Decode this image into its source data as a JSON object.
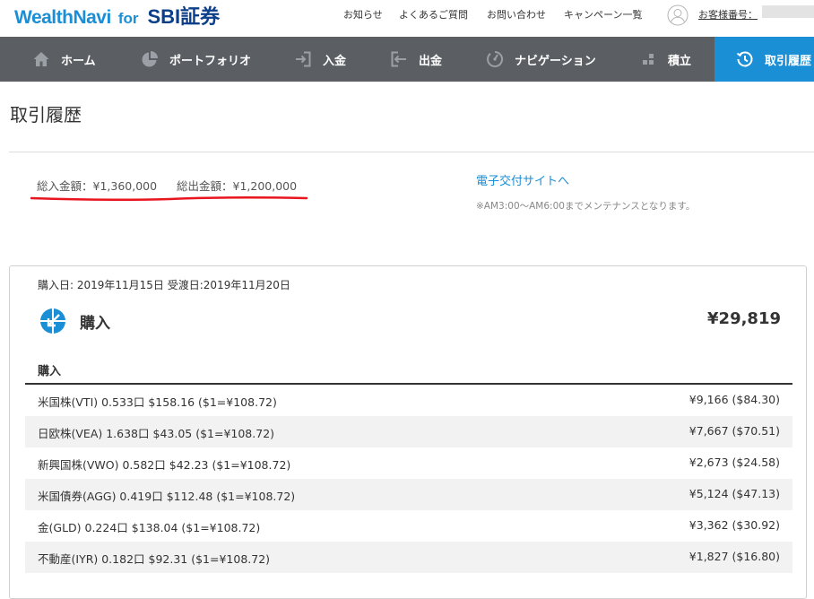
{
  "header": {
    "logo_main": "WealthNavi",
    "logo_for": "for",
    "logo_partner": "SBI証券",
    "links": [
      "お知らせ",
      "よくあるご質問",
      "お問い合わせ",
      "キャンペーン一覧"
    ],
    "customer_label": "お客様番号："
  },
  "nav": {
    "items": [
      {
        "label": "ホーム",
        "icon": "home-icon"
      },
      {
        "label": "ポートフォリオ",
        "icon": "pie-chart-icon"
      },
      {
        "label": "入金",
        "icon": "deposit-icon"
      },
      {
        "label": "出金",
        "icon": "withdraw-icon"
      },
      {
        "label": "ナビゲーション",
        "icon": "gauge-icon"
      },
      {
        "label": "積立",
        "icon": "blocks-icon"
      },
      {
        "label": "取引履歴",
        "icon": "history-icon"
      }
    ],
    "active_index": 6
  },
  "page": {
    "title": "取引履歴",
    "total_in": "総入金額：¥1,360,000",
    "total_out": "総出金額：¥1,200,000",
    "edelivery_link": "電子交付サイトへ",
    "maintenance_note": "※AM3:00〜AM6:00までメンテナンスとなります。"
  },
  "transaction": {
    "dates": "購入日: 2019年11月15日 受渡日:2019年11月20日",
    "type_label": "購入",
    "total": "¥29,819",
    "section_label": "購入",
    "rows": [
      {
        "name": "米国株(VTI) 0.533口 $158.16 ($1=¥108.72)",
        "amount": "¥9,166 ($84.30)"
      },
      {
        "name": "日欧株(VEA) 1.638口 $43.05 ($1=¥108.72)",
        "amount": "¥7,667 ($70.51)"
      },
      {
        "name": "新興国株(VWO) 0.582口 $42.23 ($1=¥108.72)",
        "amount": "¥2,673 ($24.58)"
      },
      {
        "name": "米国債券(AGG) 0.419口 $112.48 ($1=¥108.72)",
        "amount": "¥5,124 ($47.13)"
      },
      {
        "name": "金(GLD) 0.224口 $138.04 ($1=¥108.72)",
        "amount": "¥3,362 ($30.92)"
      },
      {
        "name": "不動産(IYR) 0.182口 $92.31 ($1=¥108.72)",
        "amount": "¥1,827 ($16.80)"
      }
    ]
  },
  "colors": {
    "brand_blue": "#1a8fd6",
    "nav_bg": "#5b5f63",
    "highlight_red": "#e8141e"
  }
}
